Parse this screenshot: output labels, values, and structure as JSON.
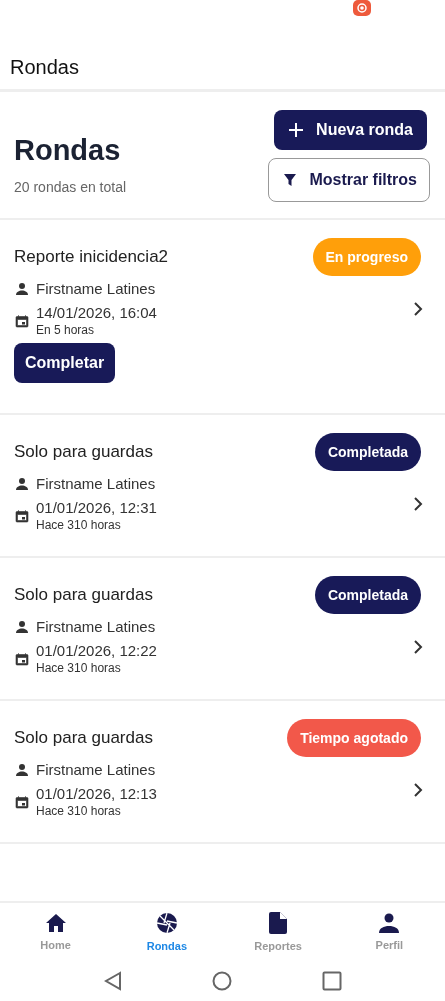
{
  "app_bar": {
    "title": "Rondas"
  },
  "header": {
    "title": "Rondas",
    "subtitle": "20 rondas en total",
    "new_button": "Nueva ronda",
    "filter_button": "Mostrar filtros"
  },
  "rounds": [
    {
      "title": "Reporte inicidencia2",
      "status": {
        "kind": "in_progress",
        "label": "En progreso"
      },
      "user": "Firstname Latines",
      "datetime": "14/01/2026, 16:04",
      "relative": "En 5 horas",
      "action": "Completar"
    },
    {
      "title": "Solo para guardas",
      "status": {
        "kind": "completed",
        "label": "Completada"
      },
      "user": "Firstname Latines",
      "datetime": "01/01/2026, 12:31",
      "relative": "Hace 310 horas"
    },
    {
      "title": "Solo para guardas",
      "status": {
        "kind": "completed",
        "label": "Completada"
      },
      "user": "Firstname Latines",
      "datetime": "01/01/2026, 12:22",
      "relative": "Hace 310 horas"
    },
    {
      "title": "Solo para guardas",
      "status": {
        "kind": "timeout",
        "label": "Tiempo agotado"
      },
      "user": "Firstname Latines",
      "datetime": "01/01/2026, 12:13",
      "relative": "Hace 310 horas"
    }
  ],
  "bottom_nav": [
    {
      "kind": "home",
      "label": "Home",
      "selected": false
    },
    {
      "kind": "rounds",
      "label": "Rondas",
      "selected": true
    },
    {
      "kind": "reports",
      "label": "Reportes",
      "selected": false
    },
    {
      "kind": "profile",
      "label": "Perfil",
      "selected": false
    }
  ]
}
